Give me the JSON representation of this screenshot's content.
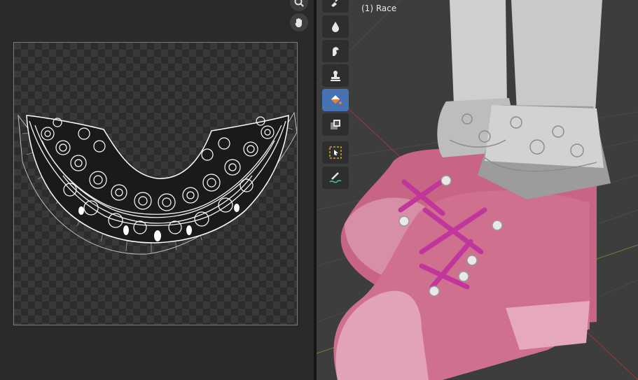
{
  "viewport": {
    "object_label": "(1) Race"
  },
  "uv_editor": {
    "nav_icons": [
      "zoom-icon",
      "hand-pan-icon"
    ]
  },
  "toolbar": {
    "tools": [
      {
        "name": "draw-brush-tool",
        "active": false
      },
      {
        "name": "blur-tool",
        "active": false
      },
      {
        "name": "smear-tool",
        "active": false
      },
      {
        "name": "clone-tool",
        "active": false
      },
      {
        "name": "fill-tool",
        "active": true
      },
      {
        "name": "mask-tool",
        "active": false
      },
      {
        "name": "select-box-tool",
        "active": false
      },
      {
        "name": "annotate-tool",
        "active": false
      }
    ],
    "active_color": "#4772b3"
  }
}
